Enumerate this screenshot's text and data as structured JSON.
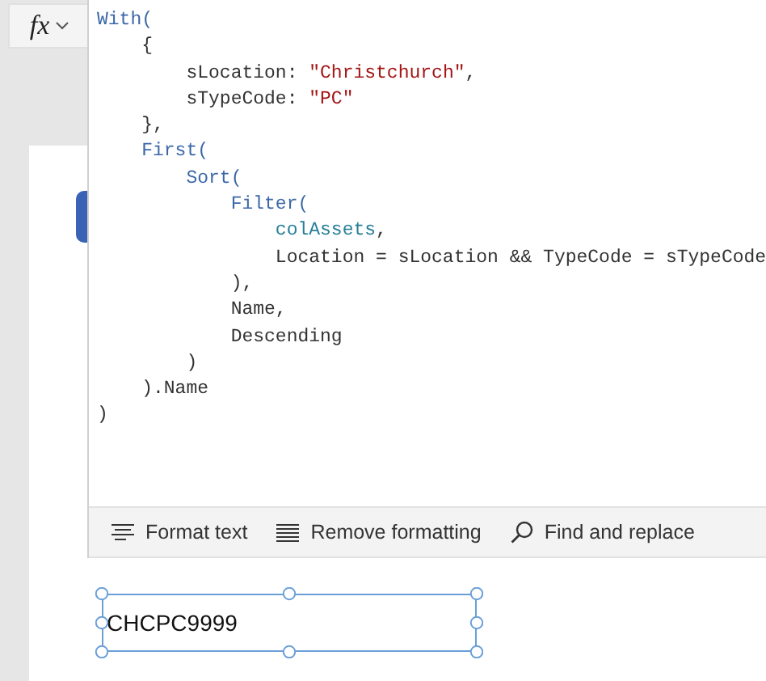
{
  "formula_bar": {
    "function_button": "fx"
  },
  "code_lines": [
    [
      {
        "kind": "keyword",
        "text": "With("
      }
    ],
    [
      {
        "kind": "plain",
        "text": "    {"
      }
    ],
    [
      {
        "kind": "plain",
        "text": "        sLocation: "
      },
      {
        "kind": "string",
        "text": "\"Christchurch\""
      },
      {
        "kind": "plain",
        "text": ","
      }
    ],
    [
      {
        "kind": "plain",
        "text": "        sTypeCode: "
      },
      {
        "kind": "string",
        "text": "\"PC\""
      }
    ],
    [
      {
        "kind": "plain",
        "text": "    },"
      }
    ],
    [
      {
        "kind": "keyword",
        "text": "    First("
      }
    ],
    [
      {
        "kind": "keyword",
        "text": "        Sort("
      }
    ],
    [
      {
        "kind": "keyword",
        "text": "            Filter("
      }
    ],
    [
      {
        "kind": "variable",
        "text": "                colAssets"
      },
      {
        "kind": "plain",
        "text": ","
      }
    ],
    [
      {
        "kind": "plain",
        "text": "                Location = sLocation && TypeCode = sTypeCode"
      }
    ],
    [
      {
        "kind": "plain",
        "text": "            ),"
      }
    ],
    [
      {
        "kind": "plain",
        "text": "            Name,"
      }
    ],
    [
      {
        "kind": "plain",
        "text": "            Descending"
      }
    ],
    [
      {
        "kind": "plain",
        "text": "        )"
      }
    ],
    [
      {
        "kind": "plain",
        "text": "    ).Name"
      }
    ],
    [
      {
        "kind": "plain",
        "text": ")"
      }
    ]
  ],
  "toolbar": [
    {
      "kind": "format",
      "label": "Format text"
    },
    {
      "kind": "remove",
      "label": "Remove formatting"
    },
    {
      "kind": "find",
      "label": "Find and replace"
    }
  ],
  "canvas": {
    "label": {
      "text": "CHCPC9999",
      "selected": true
    }
  }
}
